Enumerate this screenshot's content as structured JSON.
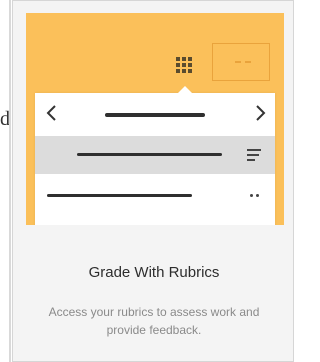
{
  "card": {
    "title": "Grade With Rubrics",
    "description": "Access your rubrics to assess work and provide feedback."
  },
  "edge": {
    "text": "d"
  },
  "colors": {
    "hero_background": "#fbc05a",
    "accent_border": "#e9a33c",
    "selected_row": "#dcdcdc"
  },
  "icons": [
    "grid-icon",
    "chevron-left-icon",
    "chevron-right-icon",
    "filter-lines-icon",
    "more-dots-icon"
  ]
}
